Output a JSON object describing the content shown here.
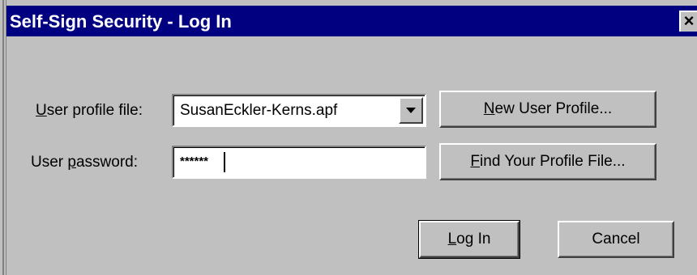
{
  "window": {
    "title": "Self-Sign Security - Log In",
    "close_glyph": "×"
  },
  "form": {
    "profile_label_u": "U",
    "profile_label_rest": "ser profile file:",
    "profile_value": "SusanEckler-Kerns.apf",
    "password_label_pre": "User ",
    "password_label_u": "p",
    "password_label_rest": "assword:",
    "password_value": "******"
  },
  "buttons": {
    "new_profile_u": "N",
    "new_profile_rest": "ew User Profile...",
    "find_profile_u": "F",
    "find_profile_rest": "ind Your Profile File...",
    "login_u": "L",
    "login_rest": "og In",
    "cancel": "Cancel"
  },
  "icons": {
    "dropdown": "chevron-down-icon",
    "close": "close-icon"
  },
  "colors": {
    "titlebar": "#000080",
    "face": "#c0c0c0"
  }
}
